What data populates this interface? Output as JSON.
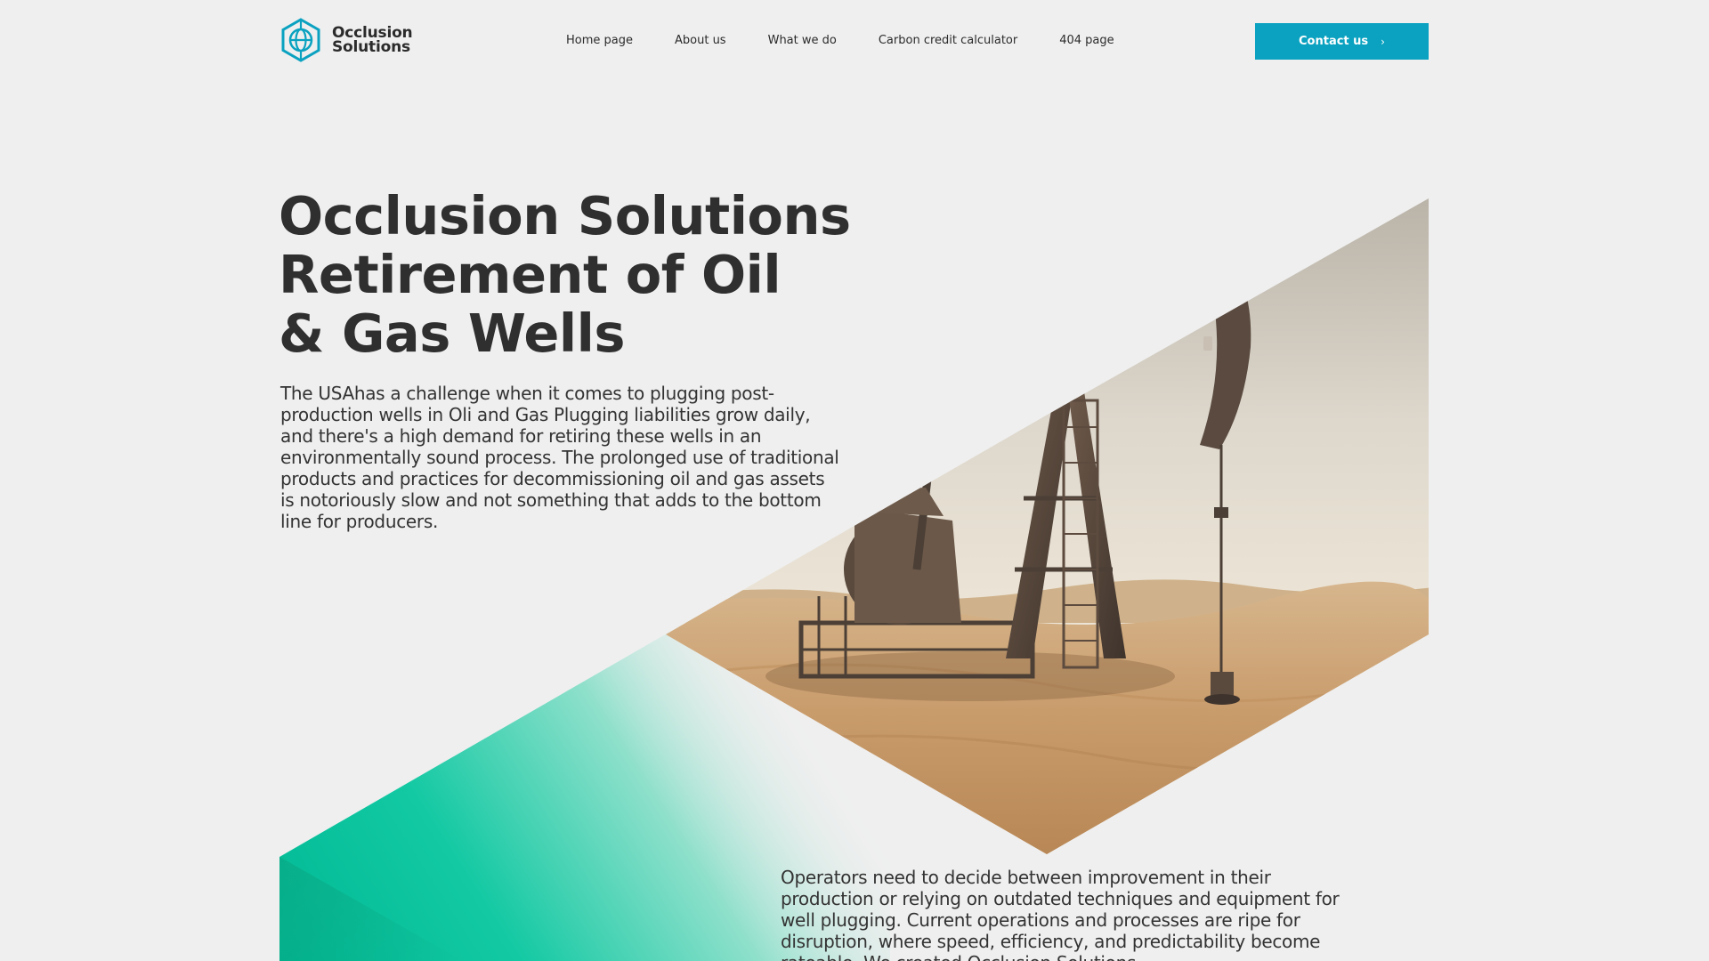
{
  "brand": {
    "name_line1": "Occlusion",
    "name_line2": "Solutions",
    "logo_icon": "hexagon-globe-icon",
    "accent": "#0aa2c0",
    "gradient_green": "#00c39a"
  },
  "nav": {
    "items": [
      {
        "label": "Home page"
      },
      {
        "label": "About us"
      },
      {
        "label": "What we do"
      },
      {
        "label": "Carbon credit calculator"
      },
      {
        "label": "404 page"
      }
    ],
    "contact_label": "Contact us",
    "contact_icon": "chevron-right-icon"
  },
  "hero": {
    "title_line1": "Occlusion Solutions",
    "title_line2": "Retirement of Oil",
    "title_line3": "& Gas Wells",
    "description": "The USAhas a challenge when it comes to plugging post-production wells in Oli and Gas Plugging liabilities grow daily, and there's a high demand for retiring these wells in an environmentally sound process. The prolonged use of traditional products and practices for decommissioning oil and gas assets is notoriously slow and not something that adds to the bottom line for producers.",
    "image": "oil-pumpjack-in-desert"
  },
  "section2": {
    "description": "Operators need to decide between improvement in their production or relying on outdated techniques and equipment for well plugging. Current operations and processes are ripe for disruption, where speed, efficiency, and predictability become rateable. We created Occlusion Solutions"
  }
}
